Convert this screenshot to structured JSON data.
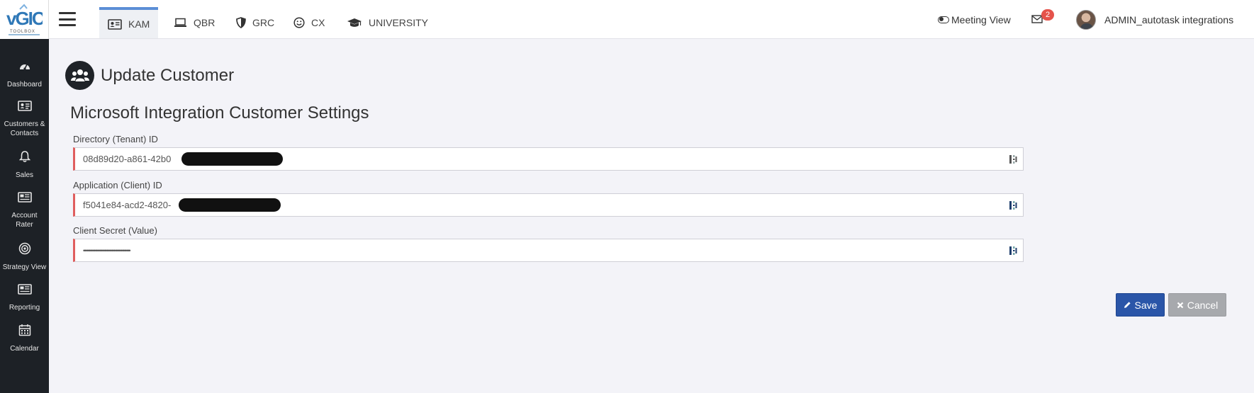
{
  "app": {
    "logo_text": "vGIO",
    "logo_sub": "TOOLBOX"
  },
  "sidebar": {
    "items": [
      {
        "label": "Dashboard",
        "icon": "dashboard-gauge-icon"
      },
      {
        "label": "Customers & Contacts",
        "icon": "id-card-icon"
      },
      {
        "label": "Sales",
        "icon": "bell-icon"
      },
      {
        "label": "Account Rater",
        "icon": "newspaper-icon"
      },
      {
        "label": "Strategy View",
        "icon": "target-icon"
      },
      {
        "label": "Reporting",
        "icon": "newspaper-icon"
      },
      {
        "label": "Calendar",
        "icon": "calendar-icon"
      }
    ]
  },
  "topbar": {
    "tabs": [
      {
        "label": "KAM",
        "icon": "id-card-icon",
        "active": true
      },
      {
        "label": "QBR",
        "icon": "laptop-icon",
        "active": false
      },
      {
        "label": "GRC",
        "icon": "shield-icon",
        "active": false
      },
      {
        "label": "CX",
        "icon": "smile-icon",
        "active": false
      },
      {
        "label": "UNIVERSITY",
        "icon": "graduation-cap-icon",
        "active": false
      }
    ],
    "meeting_view": "Meeting View",
    "mail_count": "2",
    "user_name": "ADMIN_autotask integrations"
  },
  "page": {
    "title": "Update Customer",
    "section_title": "Microsoft Integration Customer Settings",
    "fields": [
      {
        "label": "Directory (Tenant) ID",
        "value": "08d89d20-a861-42b0"
      },
      {
        "label": "Application (Client) ID",
        "value": "f5041e84-acd2-4820-"
      },
      {
        "label": "Client Secret (Value)",
        "value": "••••••••••••••••••••••••••••••••••••••••"
      }
    ],
    "buttons": {
      "save": "Save",
      "cancel": "Cancel"
    }
  },
  "colors": {
    "sidebar_bg": "#1d2126",
    "accent_tab": "#5b8ed6",
    "save_button": "#2a55a8",
    "cancel_button": "#a7a9ad",
    "required_border": "#e05e5e",
    "badge": "#e5534b"
  }
}
